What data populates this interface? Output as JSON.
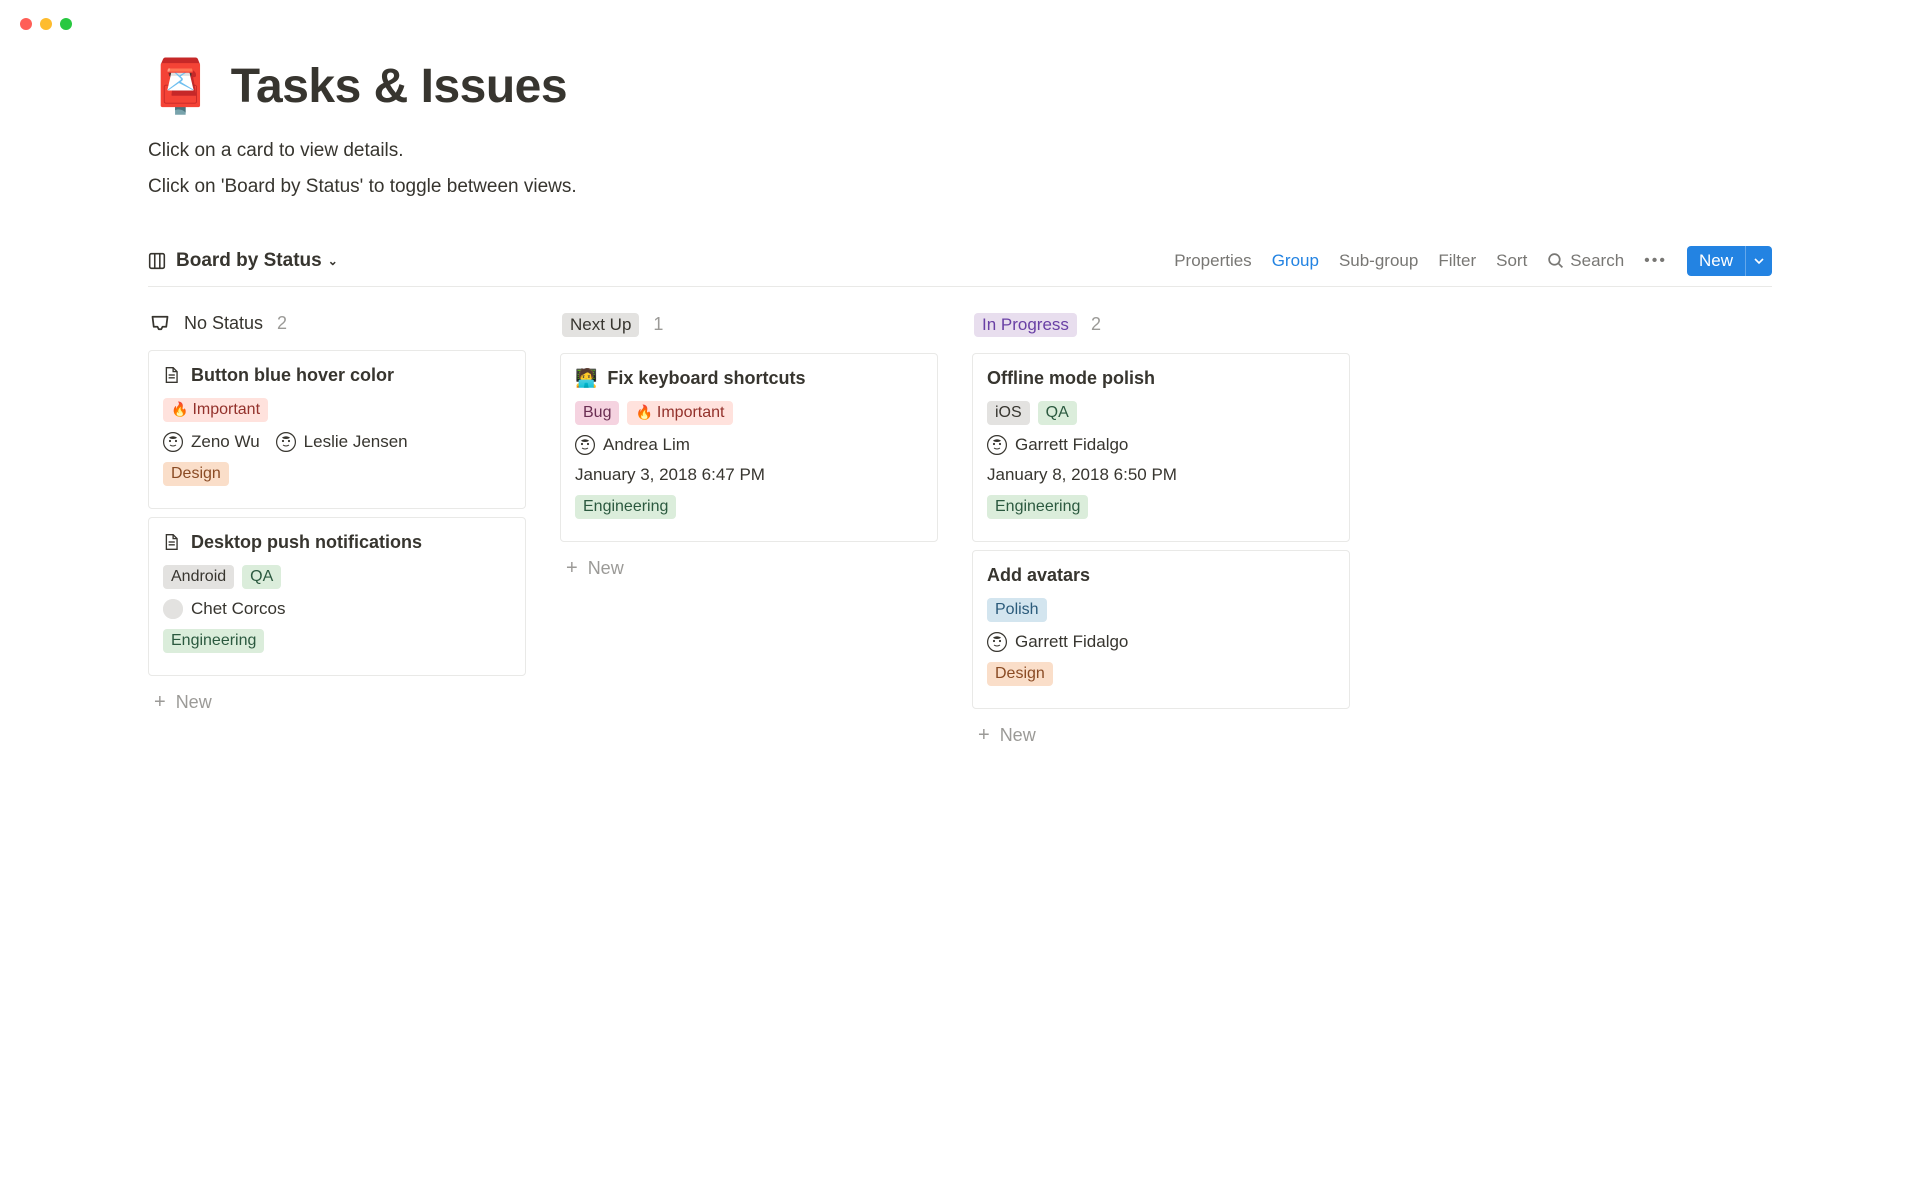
{
  "window": {
    "controls": [
      "close",
      "minimize",
      "zoom"
    ]
  },
  "header": {
    "icon": "📮",
    "title": "Tasks & Issues",
    "subtitle_lines": [
      "Click on a card to view details.",
      "Click on 'Board by Status' to toggle between views."
    ]
  },
  "toolbar": {
    "view_name": "Board by Status",
    "items": {
      "properties": "Properties",
      "group": "Group",
      "subgroup": "Sub-group",
      "filter": "Filter",
      "sort": "Sort",
      "search": "Search"
    },
    "active_item": "group",
    "new_button": "New"
  },
  "columns": [
    {
      "key": "no_status",
      "label": "No Status",
      "count": 2,
      "style": "inbox",
      "cards": [
        {
          "icon": "doc",
          "title": "Button blue hover color",
          "tags_top": [
            {
              "text": "Important",
              "style": "red",
              "emoji": "🔥"
            }
          ],
          "assignees": [
            {
              "name": "Zeno Wu"
            },
            {
              "name": "Leslie Jensen"
            }
          ],
          "tags_bottom": [
            {
              "text": "Design",
              "style": "orange"
            }
          ]
        },
        {
          "icon": "doc",
          "title": "Desktop push notifications",
          "tags_top": [
            {
              "text": "Android",
              "style": "gray"
            },
            {
              "text": "QA",
              "style": "green"
            }
          ],
          "assignees": [
            {
              "name": "Chet Corcos",
              "blank": true
            }
          ],
          "tags_bottom": [
            {
              "text": "Engineering",
              "style": "green"
            }
          ]
        }
      ],
      "add_label": "New"
    },
    {
      "key": "next_up",
      "label": "Next Up",
      "count": 1,
      "style": "pill-gray",
      "cards": [
        {
          "icon": "🧑‍💻",
          "title": "Fix keyboard shortcuts",
          "tags_top": [
            {
              "text": "Bug",
              "style": "pink"
            },
            {
              "text": "Important",
              "style": "red",
              "emoji": "🔥"
            }
          ],
          "assignees": [
            {
              "name": "Andrea Lim"
            }
          ],
          "date": "January 3, 2018 6:47 PM",
          "tags_bottom": [
            {
              "text": "Engineering",
              "style": "green"
            }
          ]
        }
      ],
      "add_label": "New"
    },
    {
      "key": "in_progress",
      "label": "In Progress",
      "count": 2,
      "style": "pill-purple",
      "cards": [
        {
          "title": "Offline mode polish",
          "tags_top": [
            {
              "text": "iOS",
              "style": "gray"
            },
            {
              "text": "QA",
              "style": "green"
            }
          ],
          "assignees": [
            {
              "name": "Garrett Fidalgo"
            }
          ],
          "date": "January 8, 2018 6:50 PM",
          "tags_bottom": [
            {
              "text": "Engineering",
              "style": "green"
            }
          ]
        },
        {
          "title": "Add avatars",
          "tags_top": [
            {
              "text": "Polish",
              "style": "blue"
            }
          ],
          "assignees": [
            {
              "name": "Garrett Fidalgo"
            }
          ],
          "tags_bottom": [
            {
              "text": "Design",
              "style": "orange"
            }
          ]
        }
      ],
      "add_label": "New"
    }
  ]
}
